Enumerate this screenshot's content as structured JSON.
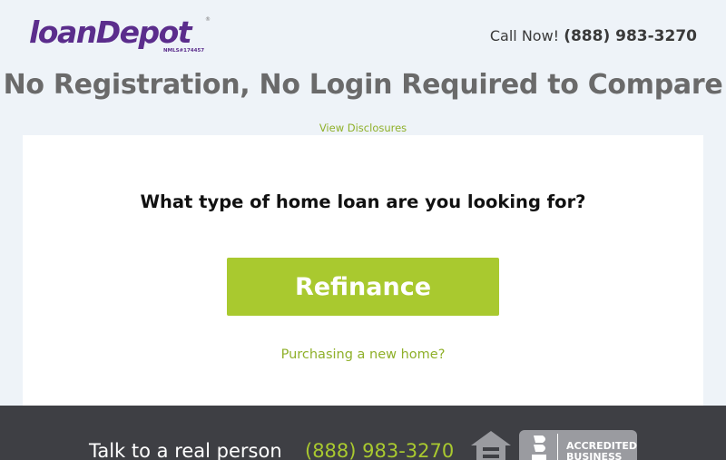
{
  "brand": {
    "logo_text": "loanDepot",
    "registered_mark": "®",
    "nmls": "NMLS#174457",
    "logo_color": "#5b2d8c",
    "logo_accent_color": "#a9c92f"
  },
  "header": {
    "call_label": "Call Now!",
    "phone": "(888) 983-3270"
  },
  "headline": "No Registration, No Login Required to Compare",
  "disclosures_link": "View Disclosures",
  "card": {
    "question": "What type of home loan are you looking for?",
    "primary_button": "Refinance",
    "secondary_link": "Purchasing a new home?"
  },
  "footer": {
    "talk_text": "Talk to a real person",
    "phone": "(888) 983-3270",
    "equal_housing_icon": "equal-housing-icon",
    "bbb_badge_text_line1": "ACCREDITED",
    "bbb_badge_text_line2": "BUSINESS"
  },
  "colors": {
    "accent_green": "#a9c92f",
    "background": "#eef3f8",
    "footer_bg": "#3e3f44",
    "headline_gray": "#6a6a6a"
  }
}
